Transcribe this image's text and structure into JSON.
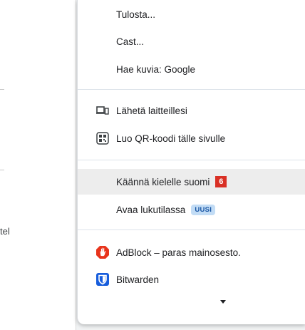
{
  "page": {
    "partial_text": "tel"
  },
  "menu": {
    "items_top": [
      {
        "label": "Tulosta..."
      },
      {
        "label": "Cast..."
      },
      {
        "label": "Hae kuvia: Google"
      }
    ],
    "send_devices": {
      "label": "Lähetä laitteillesi",
      "icon": "devices-icon"
    },
    "qr_code": {
      "label": "Luo QR-koodi tälle sivulle",
      "icon": "qr-code-icon"
    },
    "translate": {
      "label": "Käännä kielelle suomi",
      "badge": "6"
    },
    "reader_mode": {
      "label": "Avaa lukutilassa",
      "badge": "UUSI"
    },
    "adblock": {
      "label": "AdBlock – paras mainosesto.",
      "icon": "adblock-icon"
    },
    "bitwarden": {
      "label": "Bitwarden",
      "icon": "bitwarden-icon"
    }
  },
  "colors": {
    "badge_red": "#d93025",
    "badge_new_bg": "#c2dcf5",
    "adblock_red": "#e8341c",
    "bitwarden_blue": "#175ddc"
  }
}
